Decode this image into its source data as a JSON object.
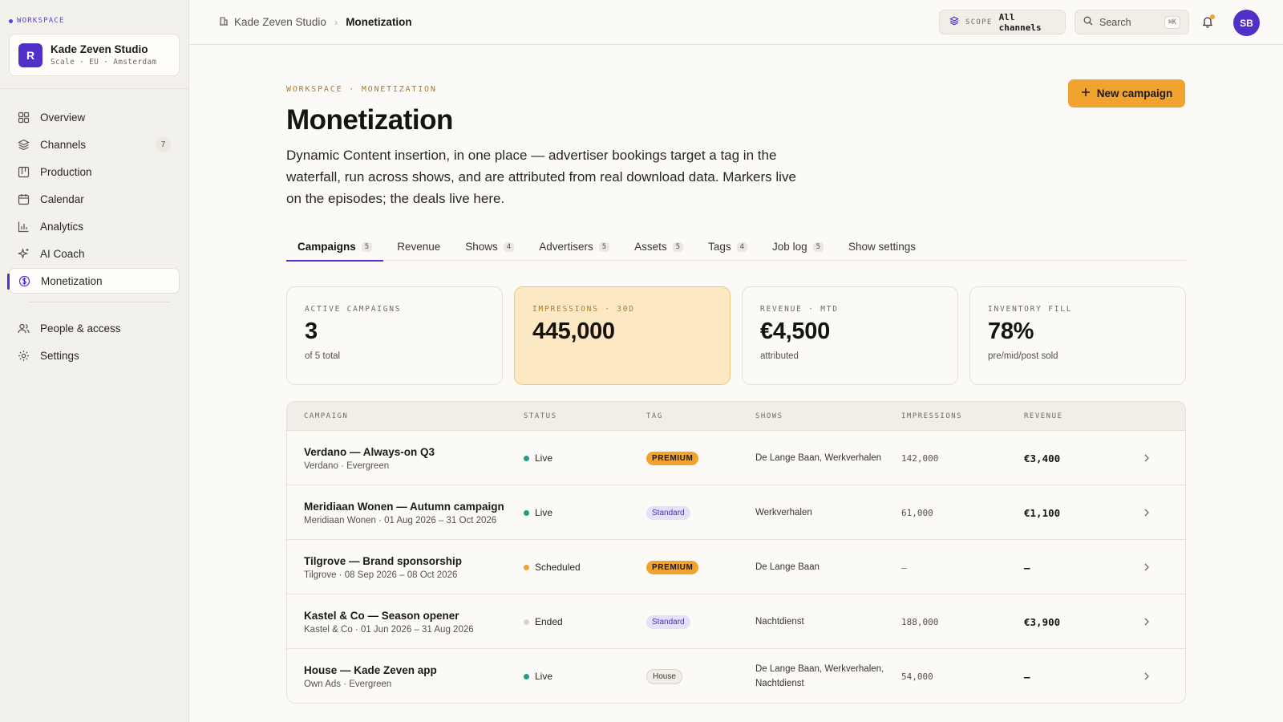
{
  "sidebar": {
    "workspace_label": "WORKSPACE",
    "workspace": {
      "initial": "R",
      "name": "Kade Zeven Studio",
      "meta": "Scale · EU · Amsterdam"
    },
    "items": [
      {
        "label": "Overview",
        "icon": "grid-icon"
      },
      {
        "label": "Channels",
        "icon": "layers-icon",
        "badge": "7"
      },
      {
        "label": "Production",
        "icon": "kanban-icon"
      },
      {
        "label": "Calendar",
        "icon": "calendar-icon"
      },
      {
        "label": "Analytics",
        "icon": "bar-chart-icon"
      },
      {
        "label": "AI Coach",
        "icon": "sparkle-icon"
      },
      {
        "label": "Monetization",
        "icon": "dollar-circle-icon",
        "active": true
      }
    ],
    "secondary": [
      {
        "label": "People & access",
        "icon": "users-icon"
      },
      {
        "label": "Settings",
        "icon": "gear-icon"
      }
    ]
  },
  "topbar": {
    "crumb_parent": "Kade Zeven Studio",
    "crumb_sep": "›",
    "crumb_current": "Monetization",
    "scope_key": "SCOPE",
    "scope_value": "All channels",
    "search_placeholder": "Search",
    "search_kbd": "⌘K",
    "user_initials": "SB"
  },
  "header": {
    "eyebrow": "WORKSPACE · MONETIZATION",
    "title": "Monetization",
    "description": "Dynamic Content insertion, in one place — advertiser bookings target a tag in the waterfall, run across shows, and are attributed from real download data. Markers live on the episodes; the deals live here.",
    "new_button": "New campaign"
  },
  "tabs": [
    {
      "label": "Campaigns",
      "count": "5",
      "active": true
    },
    {
      "label": "Revenue",
      "count": ""
    },
    {
      "label": "Shows",
      "count": "4"
    },
    {
      "label": "Advertisers",
      "count": "5"
    },
    {
      "label": "Assets",
      "count": "5"
    },
    {
      "label": "Tags",
      "count": "4"
    },
    {
      "label": "Job log",
      "count": "5"
    },
    {
      "label": "Show settings",
      "count": ""
    }
  ],
  "kpis": [
    {
      "label": "ACTIVE CAMPAIGNS",
      "value": "3",
      "sub": "of 5 total"
    },
    {
      "label": "IMPRESSIONS · 30D",
      "value": "445,000",
      "sub": "",
      "highlight": true
    },
    {
      "label": "REVENUE · MTD",
      "value": "€4,500",
      "sub": "attributed"
    },
    {
      "label": "INVENTORY FILL",
      "value": "78%",
      "sub": "pre/mid/post sold"
    }
  ],
  "table": {
    "headers": {
      "campaign": "CAMPAIGN",
      "status": "STATUS",
      "tag": "TAG",
      "shows": "SHOWS",
      "impressions": "IMPRESSIONS",
      "revenue": "REVENUE"
    },
    "rows": [
      {
        "title": "Verdano — Always-on Q3",
        "sub": "Verdano · Evergreen",
        "status": "Live",
        "status_color": "#1f9e86",
        "tag": "PREMIUM",
        "tag_kind": "premium",
        "shows": "De Lange Baan, Werkverhalen",
        "impressions": "142,000",
        "revenue": "€3,400"
      },
      {
        "title": "Meridiaan Wonen — Autumn campaign",
        "sub": "Meridiaan Wonen · 01 Aug 2026 – 31 Oct 2026",
        "status": "Live",
        "status_color": "#1f9e86",
        "tag": "Standard",
        "tag_kind": "standard",
        "shows": "Werkverhalen",
        "impressions": "61,000",
        "revenue": "€1,100"
      },
      {
        "title": "Tilgrove — Brand sponsorship",
        "sub": "Tilgrove · 08 Sep 2026 – 08 Oct 2026",
        "status": "Scheduled",
        "status_color": "#f0a22b",
        "tag": "PREMIUM",
        "tag_kind": "premium",
        "shows": "De Lange Baan",
        "impressions": "—",
        "revenue": "—"
      },
      {
        "title": "Kastel & Co — Season opener",
        "sub": "Kastel & Co · 01 Jun 2026 – 31 Aug 2026",
        "status": "Ended",
        "status_color": "#d8d4cc",
        "tag": "Standard",
        "tag_kind": "standard",
        "shows": "Nachtdienst",
        "impressions": "188,000",
        "revenue": "€3,900"
      },
      {
        "title": "House — Kade Zeven app",
        "sub": "Own Ads · Evergreen",
        "status": "Live",
        "status_color": "#1f9e86",
        "tag": "House",
        "tag_kind": "house",
        "shows": "De Lange Baan, Werkverhalen, Nachtdienst",
        "impressions": "54,000",
        "revenue": "—"
      }
    ]
  },
  "colors": {
    "brand": "#5130c7",
    "accent": "#f2a22e",
    "live": "#1f9e86",
    "scheduled": "#f0a22b",
    "ended": "#d8d4cc"
  }
}
